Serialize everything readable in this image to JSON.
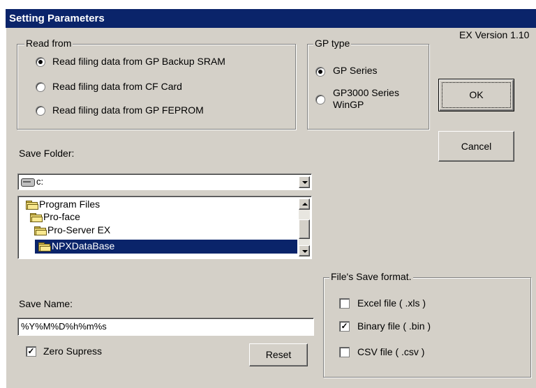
{
  "window": {
    "title": "Setting Parameters",
    "version": "EX Version 1.10"
  },
  "read_from": {
    "legend": "Read from",
    "options": [
      {
        "label": "Read filing data from GP Backup SRAM",
        "selected": true
      },
      {
        "label": "Read filing data from CF Card",
        "selected": false
      },
      {
        "label": "Read filing data from GP FEPROM",
        "selected": false
      }
    ]
  },
  "gp_type": {
    "legend": "GP type",
    "options": [
      {
        "label": "GP Series",
        "selected": true
      },
      {
        "label_line1": "GP3000 Series",
        "label_line2": "WinGP",
        "selected": false
      }
    ]
  },
  "buttons": {
    "ok": "OK",
    "cancel": "Cancel",
    "reset": "Reset"
  },
  "save_folder": {
    "label": "Save Folder:",
    "drive": "c:",
    "folders": [
      "Program Files",
      "Pro-face",
      "Pro-Server EX",
      "NPXDataBase"
    ],
    "selected_folder": "NPXDataBase"
  },
  "save_name": {
    "label": "Save Name:",
    "value": "%Y%M%D%h%m%s"
  },
  "zero_supress": {
    "label": "Zero Supress",
    "checked": true
  },
  "save_format": {
    "legend": "File's Save format.",
    "options": [
      {
        "label": "Excel file  ( .xls )",
        "checked": false
      },
      {
        "label": "Binary file ( .bin )",
        "checked": true
      },
      {
        "label": "CSV file ( .csv )",
        "checked": false
      }
    ]
  },
  "colors": {
    "title_bar": "#0a246a",
    "selection": "#0a246a",
    "face": "#d4d0c8"
  }
}
